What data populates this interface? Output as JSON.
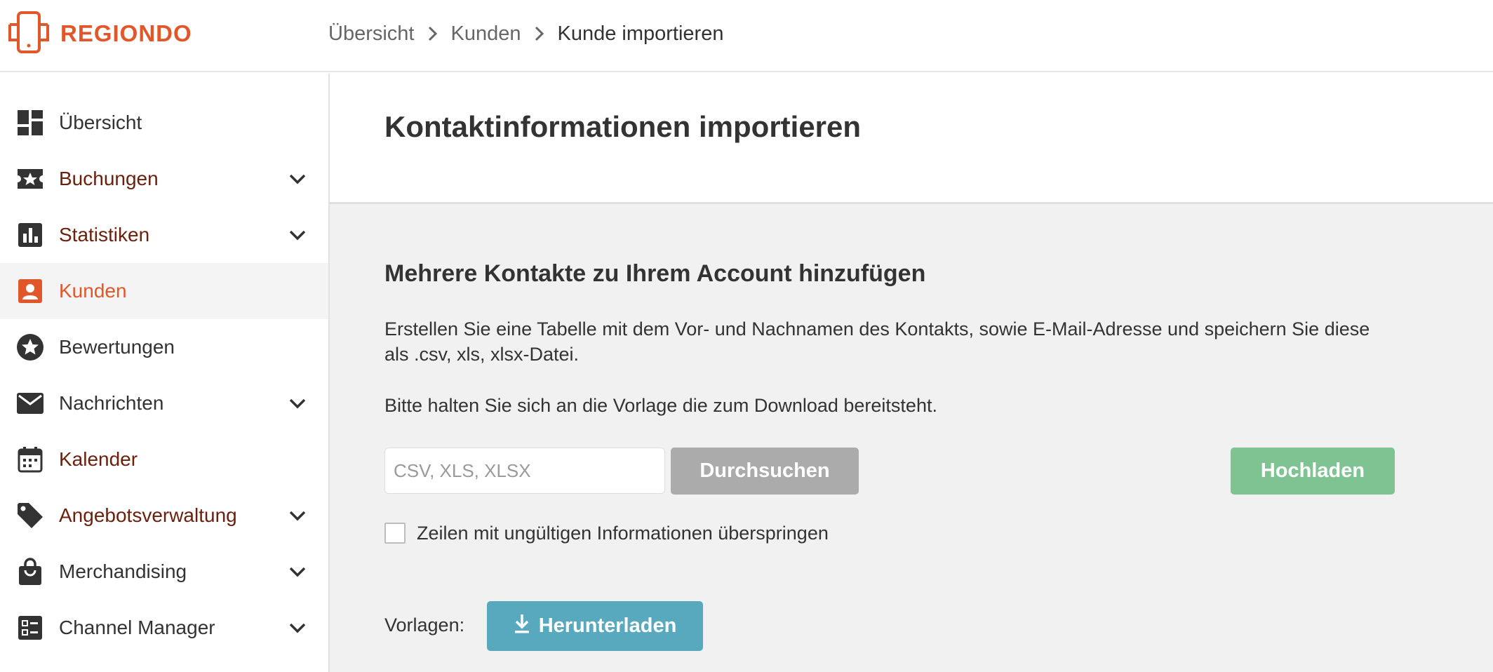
{
  "app": {
    "brand": "REGIONDO",
    "brand_color": "#e2572a"
  },
  "breadcrumb": {
    "items": [
      "Übersicht",
      "Kunden",
      "Kunde importieren"
    ]
  },
  "sidebar": {
    "items": [
      {
        "label": "Übersicht",
        "icon": "dashboard-icon",
        "expandable": false,
        "active": false
      },
      {
        "label": "Buchungen",
        "icon": "ticket-star-icon",
        "expandable": true,
        "active": false
      },
      {
        "label": "Statistiken",
        "icon": "bar-chart-icon",
        "expandable": true,
        "active": false
      },
      {
        "label": "Kunden",
        "icon": "contact-card-icon",
        "expandable": false,
        "active": true
      },
      {
        "label": "Bewertungen",
        "icon": "star-circle-icon",
        "expandable": false,
        "active": false
      },
      {
        "label": "Nachrichten",
        "icon": "envelope-icon",
        "expandable": true,
        "active": false
      },
      {
        "label": "Kalender",
        "icon": "calendar-icon",
        "expandable": false,
        "active": false
      },
      {
        "label": "Angebotsverwaltung",
        "icon": "tag-icon",
        "expandable": true,
        "active": false
      },
      {
        "label": "Merchandising",
        "icon": "shopping-bag-icon",
        "expandable": true,
        "active": false
      },
      {
        "label": "Channel Manager",
        "icon": "list-checklist-icon",
        "expandable": true,
        "active": false
      }
    ]
  },
  "main": {
    "page_title": "Kontaktinformationen importieren",
    "section_title": "Mehrere Kontakte zu Ihrem Account hinzufügen",
    "description": "Erstellen Sie eine Tabelle mit dem Vor- und Nachnamen des Kontakts, sowie E-Mail-Adresse und speichern Sie diese als .csv, xls, xlsx-Datei.",
    "hint": "Bitte halten Sie sich an die Vorlage die zum Download bereitsteht.",
    "file_input": {
      "value": "",
      "placeholder": "CSV, XLS, XLSX"
    },
    "browse_label": "Durchsuchen",
    "upload_label": "Hochladen",
    "skip_invalid": {
      "label": "Zeilen mit ungültigen Informationen überspringen",
      "checked": false
    },
    "templates_label": "Vorlagen:",
    "download_label": "Herunterladen"
  },
  "colors": {
    "accent_orange": "#e2572a",
    "maroon_text": "#6b1f0d",
    "browse_gray": "#ababab",
    "upload_green": "#7fc393",
    "download_teal": "#58a9bd"
  }
}
